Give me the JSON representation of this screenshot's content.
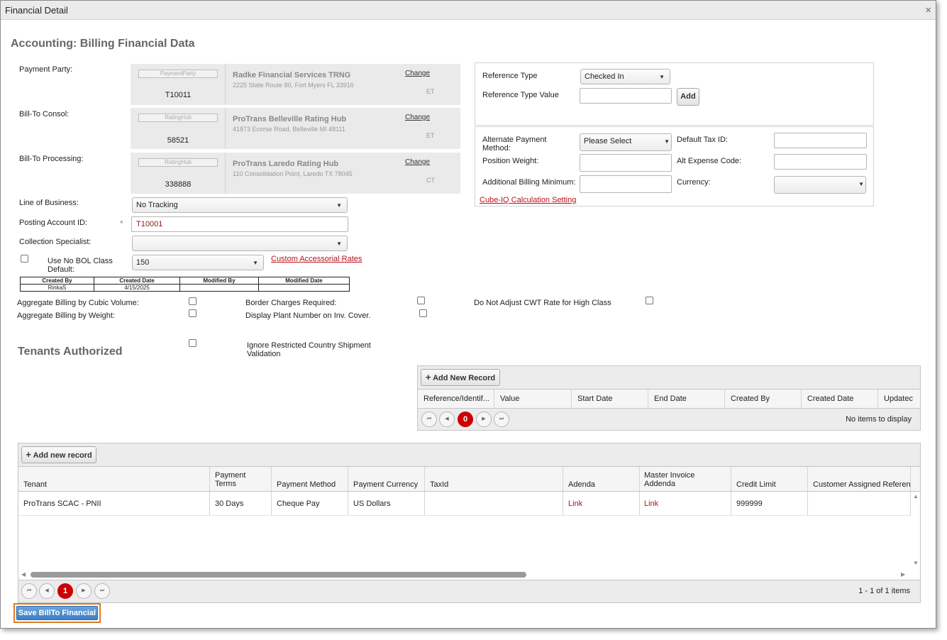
{
  "window": {
    "title": "Financial Detail",
    "close_icon": "×"
  },
  "section_title": "Accounting: Billing Financial Data",
  "payment_party": {
    "label": "Payment Party:",
    "placeholder": "PaymentParty",
    "code": "T10011",
    "name": "Radke Financial Services TRNG",
    "address": "2225 State Route 80, Fort Myers FL 33916",
    "change": "Change",
    "tz": "ET"
  },
  "bill_to_consol": {
    "label": "Bill-To Consol:",
    "placeholder": "RatingHub",
    "code": "58521",
    "name": "ProTrans Belleville Rating Hub",
    "address": "41873 Ecorse Road, Belleville MI 48111",
    "change": "Change",
    "tz": "ET"
  },
  "bill_to_processing": {
    "label": "Bill-To Processing:",
    "placeholder": "RatingHub",
    "code": "338888",
    "name": "ProTrans Laredo Rating Hub",
    "address": "110 Consolidation Point, Laredo TX 78045",
    "change": "Change",
    "tz": "CT"
  },
  "line_of_business": {
    "label": "Line of Business:",
    "value": "No Tracking"
  },
  "posting_account": {
    "label": "Posting Account ID:",
    "required": "*",
    "value": "T10001"
  },
  "collection_specialist": {
    "label": "Collection Specialist:",
    "value": ""
  },
  "no_bol_class": {
    "label": "Use No BOL Class Default:",
    "value": "150",
    "link": "Custom Accessorial Rates"
  },
  "audit_table": {
    "headers": [
      "Created By",
      "Created Date",
      "Modified By",
      "Modified Date"
    ],
    "row": [
      "RinkaS",
      "4/15/2025",
      "",
      ""
    ]
  },
  "checkboxes": {
    "agg_cubic": "Aggregate Billing by Cubic Volume:",
    "agg_weight": "Aggregate Billing by Weight:",
    "border_charges": "Border Charges Required:",
    "display_plant": "Display Plant Number on Inv. Cover.",
    "no_adjust_cwt": "Do Not Adjust CWT Rate for High Class",
    "ignore_restricted": "Ignore Restricted Country Shipment Validation"
  },
  "reference": {
    "type_label": "Reference Type",
    "type_value": "Checked In",
    "value_label": "Reference Type Value",
    "add": "Add"
  },
  "right_fields": {
    "alt_payment_label": "Alternate Payment Method:",
    "alt_payment_value": "Please Select",
    "position_weight_label": "Position Weight:",
    "additional_min_label": "Additional Billing Minimum:",
    "default_tax_label": "Default Tax ID:",
    "alt_expense_label": "Alt Expense Code:",
    "currency_label": "Currency:",
    "cube_link": "Cube-IQ Calculation Setting"
  },
  "tenants_title": "Tenants Authorized",
  "ref_grid": {
    "add": "Add New Record",
    "columns": [
      "Reference/Identif...",
      "Value",
      "Start Date",
      "End Date",
      "Created By",
      "Created Date",
      "Updatec"
    ],
    "page": "0",
    "status": "No items to display"
  },
  "tenant_grid": {
    "add": "Add new record",
    "columns": [
      "Tenant",
      "Payment\nTerms",
      "Payment Method",
      "Payment Currency",
      "TaxId",
      "Adenda",
      "Master Invoice\nAddenda",
      "Credit Limit",
      "Customer Assigned Referenc"
    ],
    "row": [
      "ProTrans SCAC - PNII",
      "30 Days",
      "Cheque Pay",
      "US Dollars",
      "",
      "Link",
      "Link",
      "999999",
      ""
    ],
    "page": "1",
    "status": "1 - 1 of 1 items"
  },
  "save_button": "Save BillTo Financial",
  "pager_icons": {
    "first": "⏮",
    "prev": "◀",
    "next": "▶",
    "last": "⏭"
  }
}
